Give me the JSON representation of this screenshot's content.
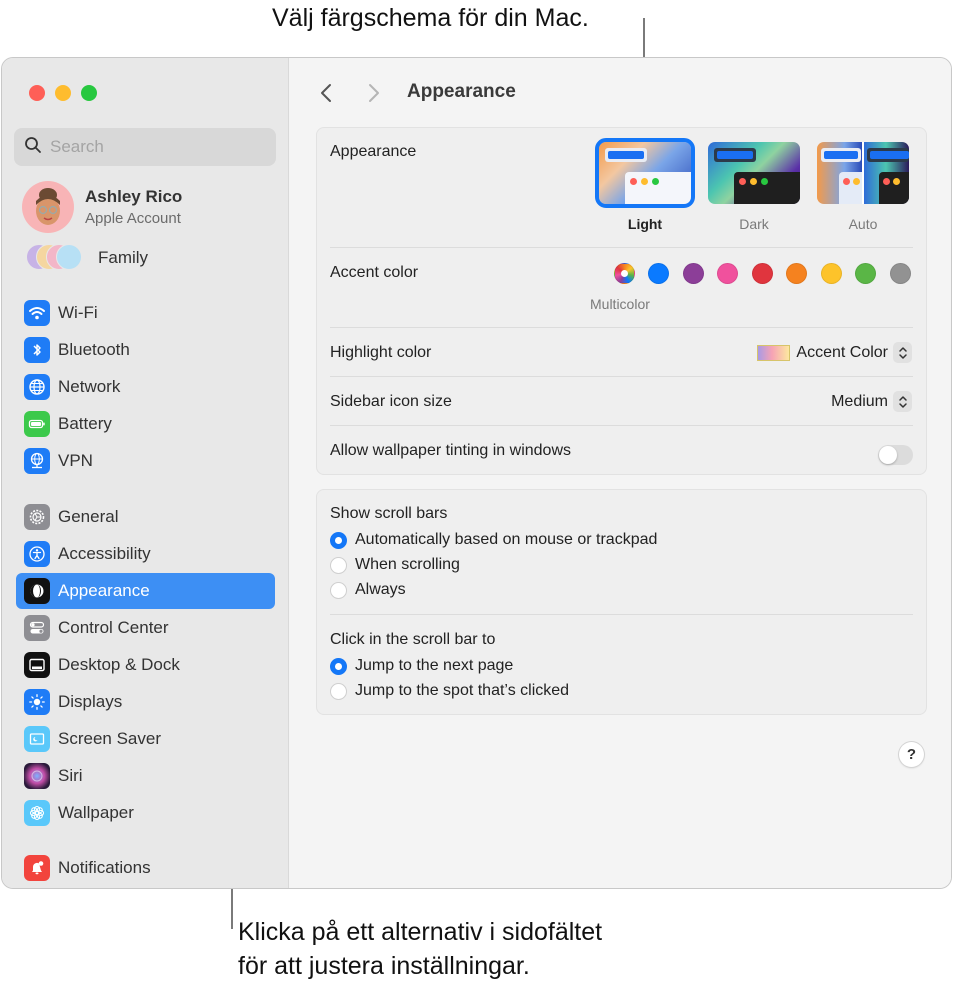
{
  "callouts": {
    "top": "Välj färgschema för din Mac.",
    "bottom_line1": "Klicka på ett alternativ i sidofältet",
    "bottom_line2": "för att justera inställningar."
  },
  "window": {
    "traffic_lights": [
      {
        "name": "close",
        "color": "#fe5f57"
      },
      {
        "name": "minimize",
        "color": "#febc2e"
      },
      {
        "name": "zoom",
        "color": "#28c840"
      }
    ]
  },
  "sidebar": {
    "search_placeholder": "Search",
    "account": {
      "name": "Ashley Rico",
      "subtitle": "Apple Account"
    },
    "family_label": "Family",
    "items": [
      {
        "label": "Wi-Fi",
        "icon": "wifi-icon",
        "color": "#1f7cf6"
      },
      {
        "label": "Bluetooth",
        "icon": "bluetooth-icon",
        "color": "#1f7cf6"
      },
      {
        "label": "Network",
        "icon": "globe-icon",
        "color": "#1f7cf6"
      },
      {
        "label": "Battery",
        "icon": "battery-icon",
        "color": "#3cc94b"
      },
      {
        "label": "VPN",
        "icon": "vpn-globe-icon",
        "color": "#1f7cf6"
      },
      {
        "label": "General",
        "icon": "gear-icon",
        "color": "#8e8e93"
      },
      {
        "label": "Accessibility",
        "icon": "accessibility-icon",
        "color": "#1f7cf6"
      },
      {
        "label": "Appearance",
        "icon": "appearance-icon",
        "color": "#111111",
        "selected": true
      },
      {
        "label": "Control Center",
        "icon": "control-center-icon",
        "color": "#8e8e93"
      },
      {
        "label": "Desktop & Dock",
        "icon": "dock-icon",
        "color": "#111111"
      },
      {
        "label": "Displays",
        "icon": "sun-icon",
        "color": "#1f7cf6"
      },
      {
        "label": "Screen Saver",
        "icon": "screen-saver-icon",
        "color": "#5ac8fa"
      },
      {
        "label": "Siri",
        "icon": "siri-icon",
        "color": "#2a1a3a"
      },
      {
        "label": "Wallpaper",
        "icon": "flower-icon",
        "color": "#5ac8fa"
      },
      {
        "label": "Notifications",
        "icon": "bell-icon",
        "color": "#f2443d"
      }
    ],
    "selected_color": "#3d8ff4"
  },
  "header": {
    "title": "Appearance"
  },
  "appearance_group": {
    "appearance_label": "Appearance",
    "themes": [
      {
        "label": "Light",
        "selected": true
      },
      {
        "label": "Dark",
        "selected": false
      },
      {
        "label": "Auto",
        "selected": false
      }
    ],
    "accent_label": "Accent color",
    "accent_colors": [
      {
        "name": "multicolor",
        "color": "conic",
        "selected": true
      },
      {
        "name": "blue",
        "color": "#0a7aff"
      },
      {
        "name": "purple",
        "color": "#8c3e98"
      },
      {
        "name": "pink",
        "color": "#f0519d"
      },
      {
        "name": "red",
        "color": "#e0353e"
      },
      {
        "name": "orange",
        "color": "#f5821f"
      },
      {
        "name": "yellow",
        "color": "#fdc32a"
      },
      {
        "name": "green",
        "color": "#5ab646"
      },
      {
        "name": "graphite",
        "color": "#929292"
      }
    ],
    "accent_caption": "Multicolor",
    "highlight_label": "Highlight color",
    "highlight_value": "Accent Color",
    "icon_size_label": "Sidebar icon size",
    "icon_size_value": "Medium",
    "tinting_label": "Allow wallpaper tinting in windows",
    "tinting_enabled": false
  },
  "scroll_group": {
    "show_label": "Show scroll bars",
    "show_options": [
      {
        "label": "Automatically based on mouse or trackpad",
        "checked": true
      },
      {
        "label": "When scrolling",
        "checked": false
      },
      {
        "label": "Always",
        "checked": false
      }
    ],
    "click_label": "Click in the scroll bar to",
    "click_options": [
      {
        "label": "Jump to the next page",
        "checked": true
      },
      {
        "label": "Jump to the spot that’s clicked",
        "checked": false
      }
    ]
  },
  "help_label": "?"
}
